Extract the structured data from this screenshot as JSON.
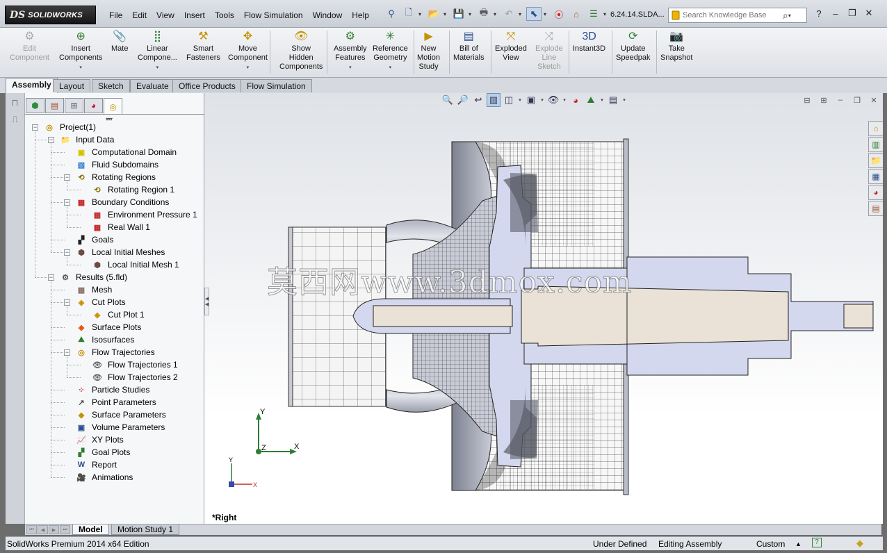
{
  "app": {
    "logo_text": "SOLIDWORKS",
    "logo_mark": "DS",
    "menu": [
      "File",
      "Edit",
      "View",
      "Insert",
      "Tools",
      "Flow Simulation",
      "Window",
      "Help"
    ],
    "filename": "6.24.14.SLDA...",
    "search": {
      "placeholder": "Search Knowledge Base"
    }
  },
  "commands": [
    {
      "label": "Edit\nComponent",
      "icon": "edit-component-icon",
      "disabled": true
    },
    {
      "label": "Insert\nComponents",
      "icon": "insert-components-icon"
    },
    {
      "label": "Mate",
      "icon": "mate-icon"
    },
    {
      "label": "Linear\nCompone...",
      "icon": "linear-pattern-icon"
    },
    {
      "label": "Smart\nFasteners",
      "icon": "smart-fasteners-icon"
    },
    {
      "label": "Move\nComponent",
      "icon": "move-component-icon"
    },
    {
      "label": "Show\nHidden\nComponents",
      "icon": "show-hidden-icon"
    },
    {
      "label": "Assembly\nFeatures",
      "icon": "assembly-features-icon"
    },
    {
      "label": "Reference\nGeometry",
      "icon": "reference-geometry-icon"
    },
    {
      "label": "New\nMotion\nStudy",
      "icon": "motion-study-icon"
    },
    {
      "label": "Bill of\nMaterials",
      "icon": "bom-icon"
    },
    {
      "label": "Exploded\nView",
      "icon": "exploded-view-icon"
    },
    {
      "label": "Explode\nLine\nSketch",
      "icon": "explode-line-icon",
      "disabled": true
    },
    {
      "label": "Instant3D",
      "icon": "instant3d-icon"
    },
    {
      "label": "Update\nSpeedpak",
      "icon": "speedpak-icon"
    },
    {
      "label": "Take\nSnapshot",
      "icon": "snapshot-icon"
    }
  ],
  "tabs": [
    "Assembly",
    "Layout",
    "Sketch",
    "Evaluate",
    "Office Products",
    "Flow Simulation"
  ],
  "tree": [
    {
      "label": "Project(1)",
      "icon": "project-icon"
    },
    {
      "label": "Input Data",
      "icon": "folder-icon"
    },
    {
      "label": "Computational Domain",
      "icon": "domain-icon"
    },
    {
      "label": "Fluid Subdomains",
      "icon": "fluid-subdomain-icon"
    },
    {
      "label": "Rotating Regions",
      "icon": "rotating-regions-icon"
    },
    {
      "label": "Rotating Region 1",
      "icon": "rotating-region-icon"
    },
    {
      "label": "Boundary Conditions",
      "icon": "boundary-conditions-icon"
    },
    {
      "label": "Environment Pressure 1",
      "icon": "pressure-icon"
    },
    {
      "label": "Real Wall 1",
      "icon": "wall-icon"
    },
    {
      "label": "Goals",
      "icon": "goals-icon"
    },
    {
      "label": "Local Initial Meshes",
      "icon": "local-mesh-icon"
    },
    {
      "label": "Local Initial Mesh 1",
      "icon": "local-mesh-item-icon"
    },
    {
      "label": "Results (5.fld)",
      "icon": "results-icon"
    },
    {
      "label": "Mesh",
      "icon": "mesh-icon"
    },
    {
      "label": "Cut Plots",
      "icon": "cut-plots-icon"
    },
    {
      "label": "Cut Plot 1",
      "icon": "cut-plot-icon"
    },
    {
      "label": "Surface Plots",
      "icon": "surface-plots-icon"
    },
    {
      "label": "Isosurfaces",
      "icon": "isosurfaces-icon"
    },
    {
      "label": "Flow Trajectories",
      "icon": "flow-trajectories-icon"
    },
    {
      "label": "Flow Trajectories 1",
      "icon": "eye-icon"
    },
    {
      "label": "Flow Trajectories 2",
      "icon": "eye-icon"
    },
    {
      "label": "Particle Studies",
      "icon": "particle-studies-icon"
    },
    {
      "label": "Point Parameters",
      "icon": "point-parameters-icon"
    },
    {
      "label": "Surface Parameters",
      "icon": "surface-parameters-icon"
    },
    {
      "label": "Volume Parameters",
      "icon": "volume-parameters-icon"
    },
    {
      "label": "XY Plots",
      "icon": "xy-plots-icon"
    },
    {
      "label": "Goal Plots",
      "icon": "goal-plots-icon"
    },
    {
      "label": "Report",
      "icon": "report-icon"
    },
    {
      "label": "Animations",
      "icon": "animations-icon"
    }
  ],
  "graphics": {
    "view_label": "*Right",
    "watermark": "莫西网www.3dmox.com",
    "triad": {
      "y": "Y",
      "x": "X",
      "z": "Z"
    }
  },
  "bottom_tabs": [
    "Model",
    "Motion Study 1"
  ],
  "status": {
    "edition": "SolidWorks Premium 2014 x64 Edition",
    "definition": "Under Defined",
    "mode": "Editing Assembly",
    "units": "Custom"
  },
  "colors": {
    "part_fill": "#d4d8ee",
    "shaft_fill": "#eae2d6",
    "mesh_line": "#3a3a3a",
    "accent_blue": "#2b4f8c"
  }
}
